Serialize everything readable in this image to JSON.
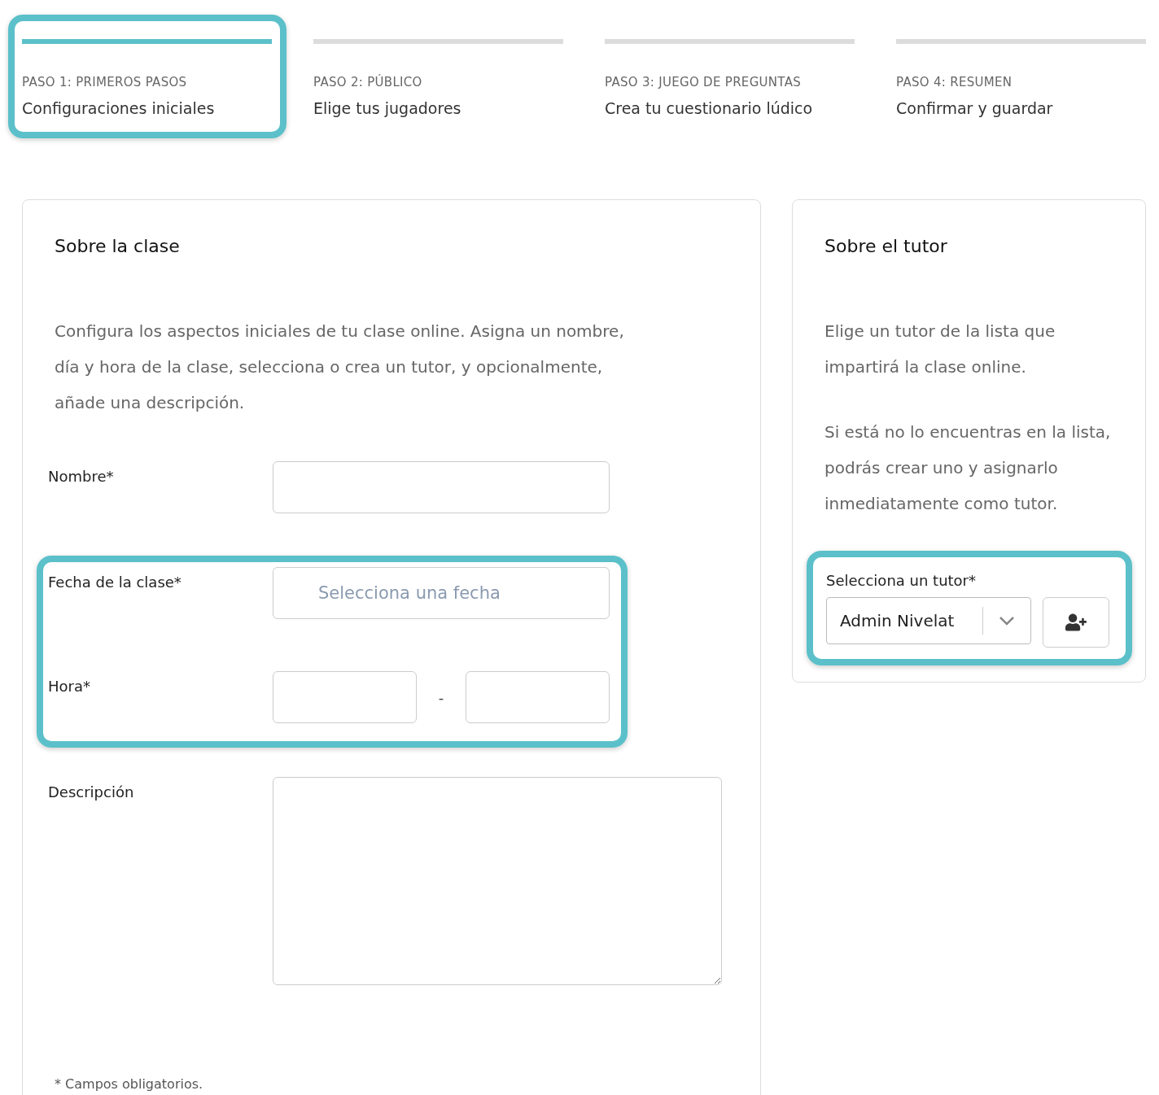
{
  "steps": [
    {
      "label": "PASO 1: PRIMEROS PASOS",
      "title": "Configuraciones iniciales",
      "selected": true
    },
    {
      "label": "PASO 2: PÚBLICO",
      "title": "Elige tus jugadores",
      "selected": false
    },
    {
      "label": "PASO 3: JUEGO DE PREGUNTAS",
      "title": "Crea tu cuestionario lúdico",
      "selected": false
    },
    {
      "label": "PASO 4: RESUMEN",
      "title": "Confirmar y guardar",
      "selected": false
    }
  ],
  "class_card": {
    "title": "Sobre la clase",
    "description": "Configura los aspectos iniciales de tu clase online. Asigna un nombre, día y hora de la clase, selecciona o crea un tutor, y opcionalmente, añade una descripción.",
    "groups": [
      {
        "highlighted": false,
        "fields": [
          {
            "kind": "text",
            "label": "Nombre*"
          }
        ]
      },
      {
        "highlighted": true,
        "fields": [
          {
            "kind": "date",
            "label": "Fecha de la clase*",
            "placeholder": "Selecciona una fecha"
          },
          {
            "kind": "time_range",
            "label": "Hora*",
            "separator": "-"
          }
        ]
      },
      {
        "highlighted": false,
        "fields": [
          {
            "kind": "textarea",
            "label": "Descripción"
          }
        ]
      }
    ],
    "footnote": "* Campos obligatorios."
  },
  "tutor_card": {
    "title": "Sobre el tutor",
    "paragraphs": [
      "Elige un tutor de la lista que impartirá la clase online.",
      "Si está no lo encuentras en la lista, podrás crear uno y asignarlo inmediatamente como tutor."
    ],
    "highlighted": true,
    "select_label": "Selecciona un tutor*",
    "select_value": "Admin Nivelat"
  }
}
